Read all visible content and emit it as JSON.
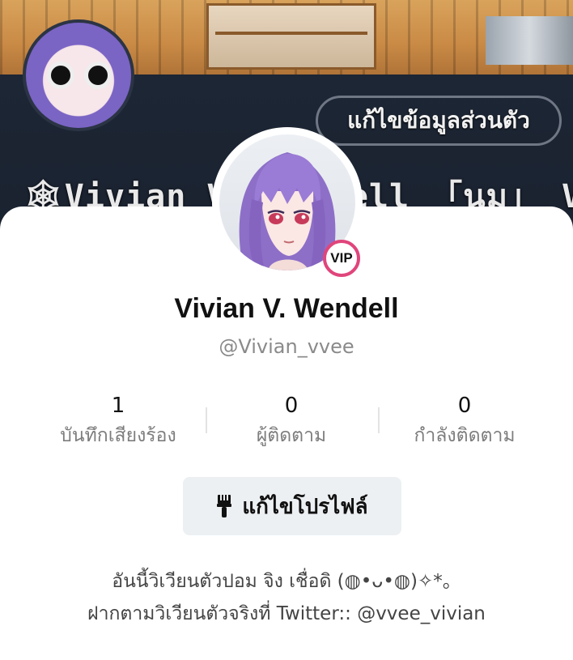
{
  "banner": {
    "edit_label": "แก้ไขข้อมูลส่วนตัว",
    "name_text": "🕸Vivian V. Wendell 「นม」 Vtuber"
  },
  "profile": {
    "vip_label": "VIP",
    "display_name": "Vivian V. Wendell",
    "username": "@Vivian_vvee",
    "stats": [
      {
        "value": "1",
        "label": "บันทึกเสียงร้อง"
      },
      {
        "value": "0",
        "label": "ผู้ติดตาม"
      },
      {
        "value": "0",
        "label": "กำลังติดตาม"
      }
    ],
    "edit_button_label": "แก้ไขโปรไฟล์",
    "bio_lines": [
      "อันนี้วิเวียนตัวปอม จิง เชื่อดิ (◍•ᴗ•◍)✧*。",
      "ฝากตามวิเวียนตัวจริงที่ Twitter:: @vvee_vivian"
    ]
  },
  "colors": {
    "vip_ring": "#e0457b",
    "button_bg": "#edf0f2",
    "banner_dark": "#1c2533"
  },
  "icons": {
    "edit_profile": "brush-icon"
  }
}
